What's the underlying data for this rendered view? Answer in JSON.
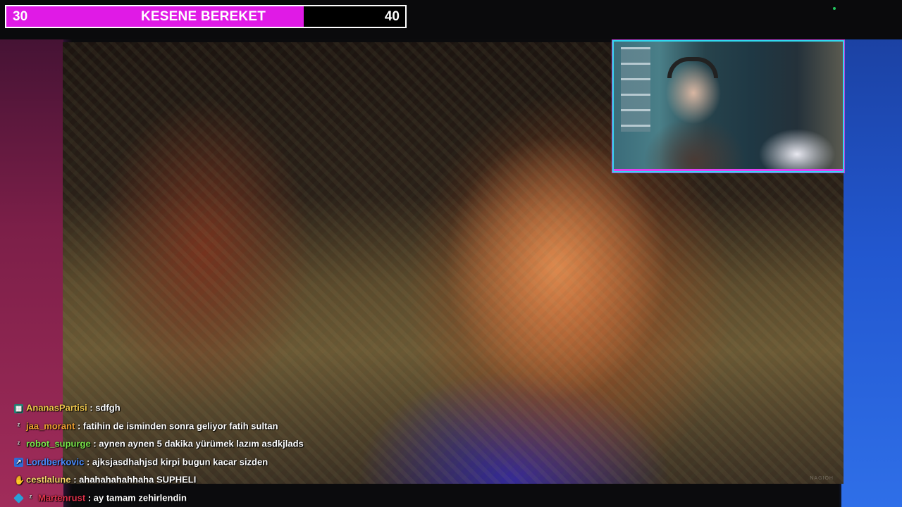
{
  "goal": {
    "start": "30",
    "end": "40",
    "title": "KESENE BEREKET",
    "progress_fraction": 0.745,
    "fill_color": "#e01ae6"
  },
  "video": {
    "watermark": "NAGIOH"
  },
  "chat": {
    "separator": " : ",
    "messages": [
      {
        "user": "AnanasPartisi",
        "color": "#f2c94c",
        "badges": [
          "subscriber-icon"
        ],
        "text": "sdfgh"
      },
      {
        "user": "jaa_morant",
        "color": "#f0a030",
        "badges": [
          "sleep-icon"
        ],
        "text": "fatihin de isminden sonra geliyor fatih sultan"
      },
      {
        "user": "robot_supurge",
        "color": "#7be84b",
        "badges": [
          "sleep-icon"
        ],
        "text": "aynen aynen 5 dakika yürümek lazım asdkjlads"
      },
      {
        "user": "Lordberkovic",
        "color": "#4a8cff",
        "badges": [
          "prime-icon"
        ],
        "text": "ajksjasdhahjsd kirpi bugun kacar sizden"
      },
      {
        "user": "cestlalune",
        "color": "#f7d36a",
        "badges": [
          "hand-icon"
        ],
        "text": "ahahahahahhaha SUPHELI"
      },
      {
        "user": "Martenrust",
        "color": "#e0304a",
        "badges": [
          "cube-icon",
          "sleep-icon"
        ],
        "text": "ay tamam zehirlendin"
      }
    ]
  }
}
